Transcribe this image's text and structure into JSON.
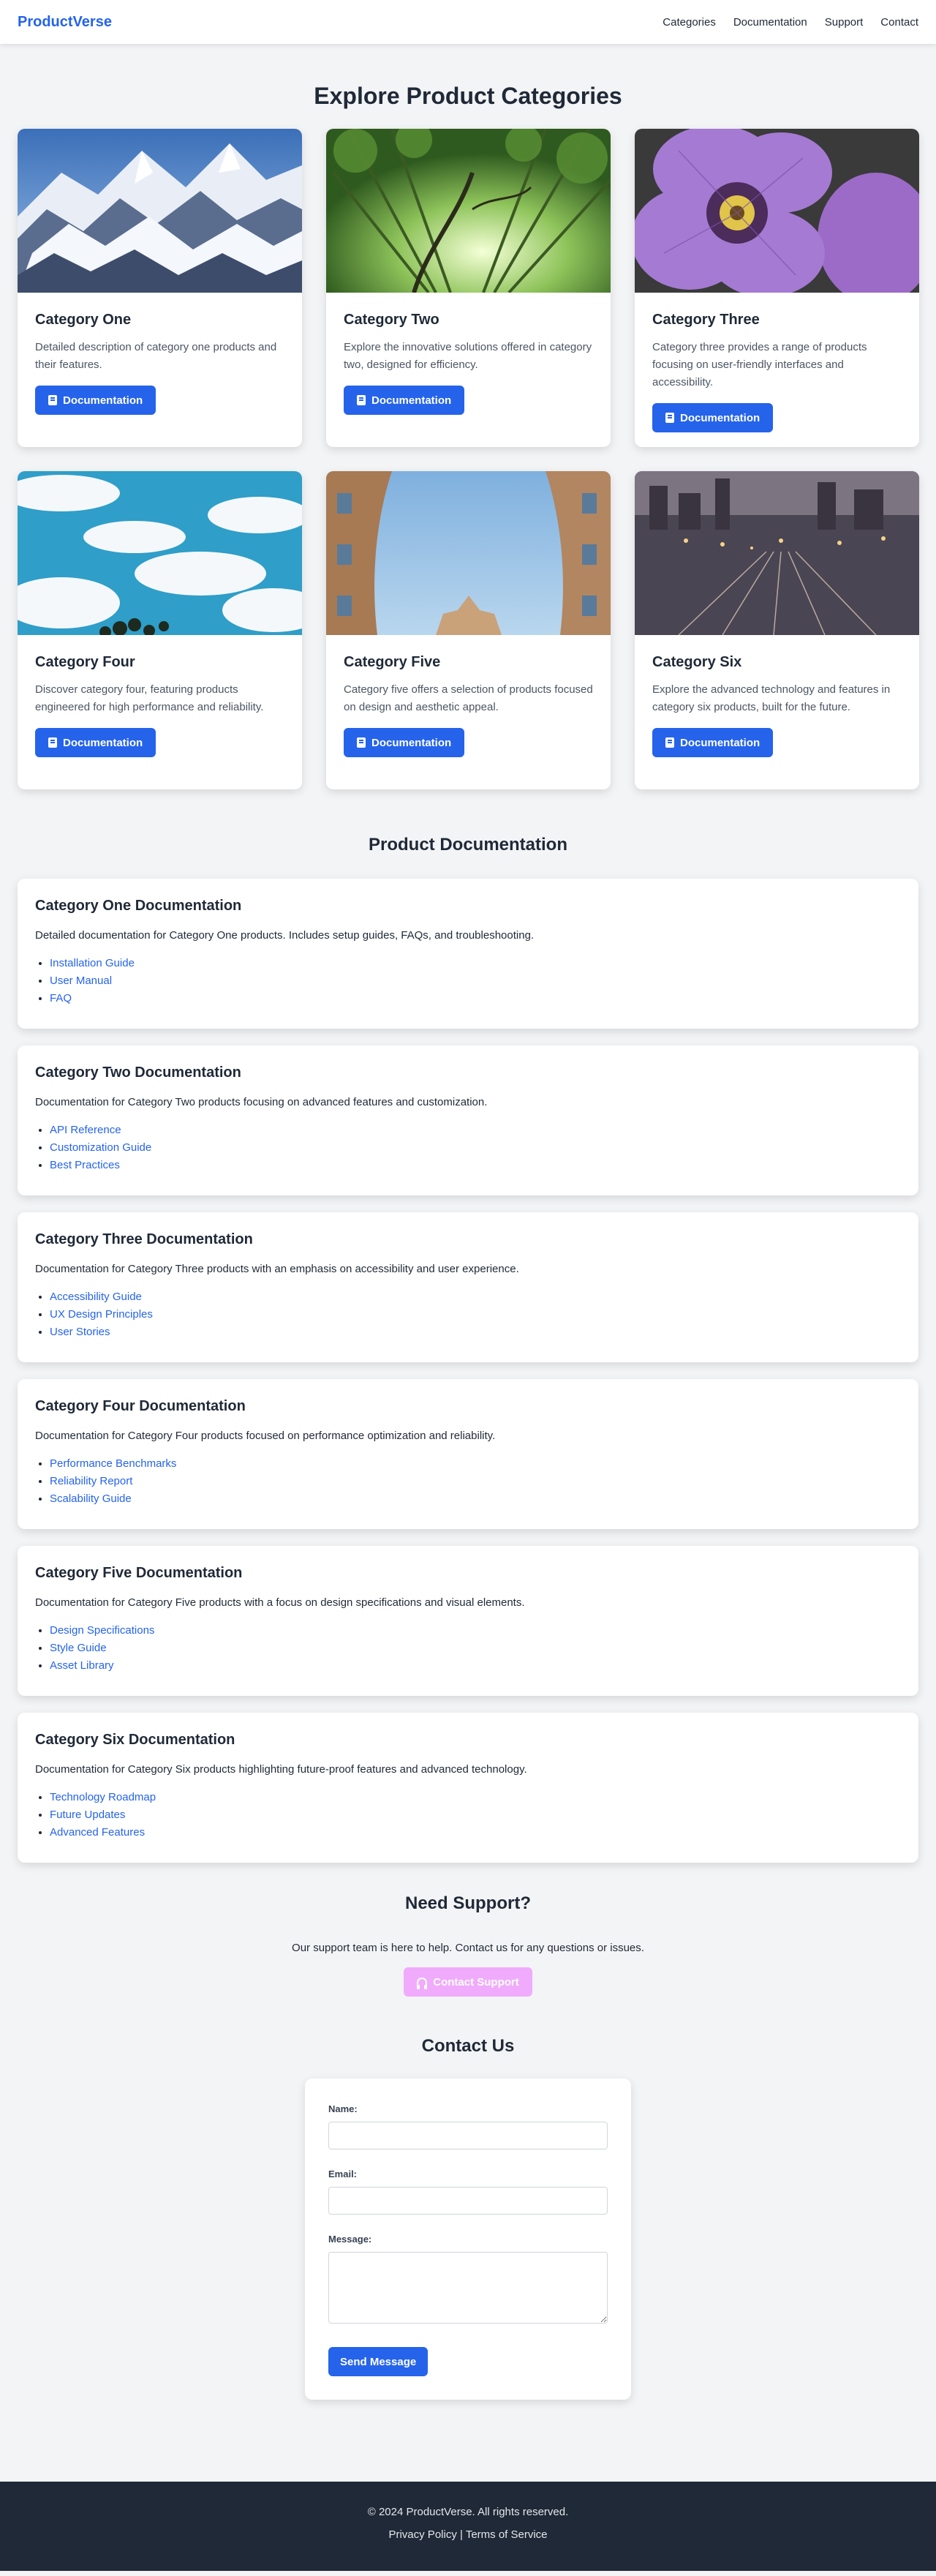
{
  "header": {
    "brand": "ProductVerse",
    "nav": [
      "Categories",
      "Documentation",
      "Support",
      "Contact"
    ]
  },
  "categories_section": {
    "title": "Explore Product Categories",
    "button_label": "Documentation",
    "items": [
      {
        "title": "Category One",
        "description": "Detailed description of category one products and their features.",
        "image": "snowy-mountain"
      },
      {
        "title": "Category Two",
        "description": "Explore the innovative solutions offered in category two, designed for efficiency.",
        "image": "bamboo-forest"
      },
      {
        "title": "Category Three",
        "description": "Category three provides a range of products focusing on user-friendly interfaces and accessibility.",
        "image": "purple-flower"
      },
      {
        "title": "Category Four",
        "description": "Discover category four, featuring products engineered for high performance and reliability.",
        "image": "blue-sky-clouds"
      },
      {
        "title": "Category Five",
        "description": "Category five offers a selection of products focused on design and aesthetic appeal.",
        "image": "buildings-looking-up"
      },
      {
        "title": "Category Six",
        "description": "Explore the advanced technology and features in category six products, built for the future.",
        "image": "city-railway-night"
      }
    ]
  },
  "docs_section": {
    "title": "Product Documentation",
    "items": [
      {
        "title": "Category One Documentation",
        "description": "Detailed documentation for Category One products. Includes setup guides, FAQs, and troubleshooting.",
        "links": [
          "Installation Guide",
          "User Manual",
          "FAQ"
        ]
      },
      {
        "title": "Category Two Documentation",
        "description": "Documentation for Category Two products focusing on advanced features and customization.",
        "links": [
          "API Reference",
          "Customization Guide",
          "Best Practices"
        ]
      },
      {
        "title": "Category Three Documentation",
        "description": "Documentation for Category Three products with an emphasis on accessibility and user experience.",
        "links": [
          "Accessibility Guide",
          "UX Design Principles",
          "User Stories"
        ]
      },
      {
        "title": "Category Four Documentation",
        "description": "Documentation for Category Four products focused on performance optimization and reliability.",
        "links": [
          "Performance Benchmarks",
          "Reliability Report",
          "Scalability Guide"
        ]
      },
      {
        "title": "Category Five Documentation",
        "description": "Documentation for Category Five products with a focus on design specifications and visual elements.",
        "links": [
          "Design Specifications",
          "Style Guide",
          "Asset Library"
        ]
      },
      {
        "title": "Category Six Documentation",
        "description": "Documentation for Category Six products highlighting future-proof features and advanced technology.",
        "links": [
          "Technology Roadmap",
          "Future Updates",
          "Advanced Features"
        ]
      }
    ]
  },
  "support": {
    "title": "Need Support?",
    "text": "Our support team is here to help. Contact us for any questions or issues.",
    "button_label": "Contact Support"
  },
  "contact": {
    "title": "Contact Us",
    "name_label": "Name:",
    "email_label": "Email:",
    "message_label": "Message:",
    "name_value": "",
    "email_value": "",
    "message_value": "",
    "send_label": "Send Message"
  },
  "footer": {
    "copyright": "© 2024 ProductVerse. All rights reserved.",
    "privacy": "Privacy Policy",
    "separator": "|",
    "terms": "Terms of Service"
  },
  "colors": {
    "primary": "#2563eb",
    "support_button": "#f0abfc",
    "footer_bg": "#1f2937",
    "page_bg": "#f3f4f6"
  }
}
